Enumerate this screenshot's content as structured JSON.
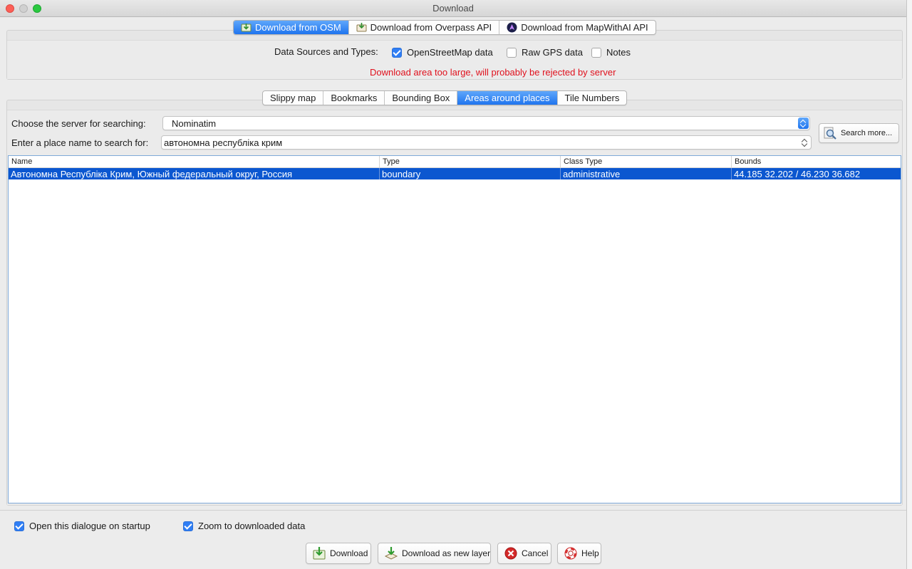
{
  "window": {
    "title": "Download"
  },
  "source_tabs": [
    {
      "label": "Download from OSM",
      "icon": "osm-download-icon",
      "active": true
    },
    {
      "label": "Download from Overpass API",
      "icon": "overpass-icon",
      "active": false
    },
    {
      "label": "Download from MapWithAI API",
      "icon": "mapwithai-icon",
      "active": false
    }
  ],
  "data_sources": {
    "label": "Data Sources and Types:",
    "options": [
      {
        "label": "OpenStreetMap data",
        "checked": true
      },
      {
        "label": "Raw GPS data",
        "checked": false
      },
      {
        "label": "Notes",
        "checked": false
      }
    ],
    "warning": "Download area too large, will probably be rejected by server"
  },
  "area_tabs": [
    {
      "label": "Slippy map",
      "active": false
    },
    {
      "label": "Bookmarks",
      "active": false
    },
    {
      "label": "Bounding Box",
      "active": false
    },
    {
      "label": "Areas around places",
      "active": true
    },
    {
      "label": "Tile Numbers",
      "active": false
    }
  ],
  "search": {
    "server_label": "Choose the server for searching:",
    "server_value": "Nominatim",
    "place_label": "Enter a place name to search for:",
    "place_value": "автономна республіка крим",
    "search_more": "Search more..."
  },
  "results": {
    "columns": [
      "Name",
      "Type",
      "Class Type",
      "Bounds"
    ],
    "rows": [
      {
        "name": "Автономна Республіка Крим, Южный федеральный округ, Россия",
        "type": "boundary",
        "class_type": "administrative",
        "bounds": "44.185 32.202 / 46.230 36.682",
        "selected": true
      }
    ]
  },
  "footer": {
    "open_on_startup": {
      "label": "Open this dialogue on startup",
      "checked": true
    },
    "zoom_to_data": {
      "label": "Zoom to downloaded data",
      "checked": true
    },
    "buttons": {
      "download": "Download",
      "download_new_layer": "Download as new layer",
      "cancel": "Cancel",
      "help": "Help"
    }
  },
  "colors": {
    "accent": "#1f74ee",
    "selection": "#0b57d0",
    "warning": "#e0111d"
  }
}
